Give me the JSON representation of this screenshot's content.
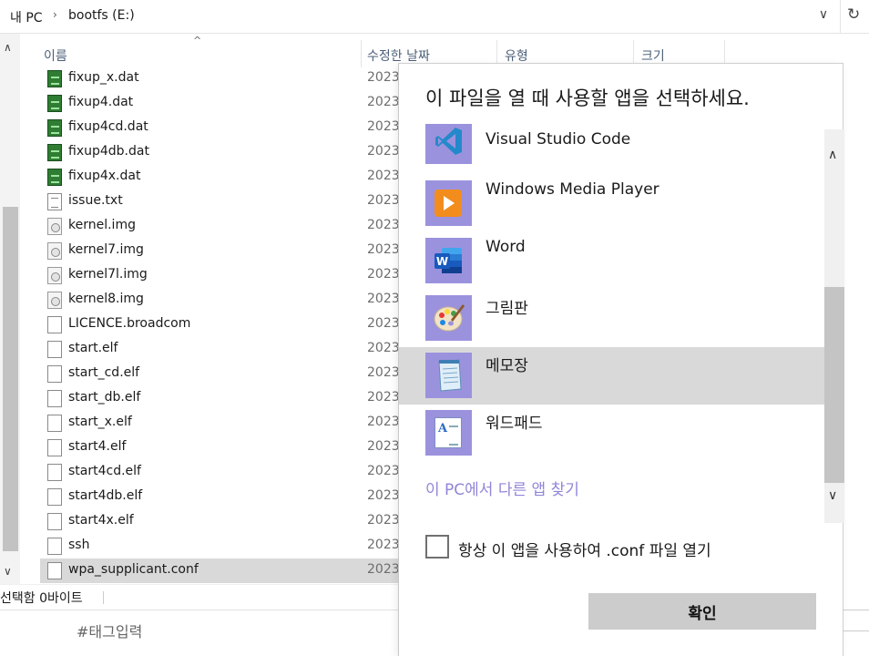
{
  "address_bar": {
    "crumbs": [
      "내 PC",
      "bootfs (E:)"
    ],
    "separator": "›",
    "dropdown_glyph": "∨",
    "refresh_glyph": "↻"
  },
  "columns": {
    "name": "이름",
    "modified": "수정한 날짜",
    "type": "유형",
    "size": "크기"
  },
  "files": [
    {
      "name": "fixup_x.dat",
      "date": "2023",
      "icon": "dat-file-icon"
    },
    {
      "name": "fixup4.dat",
      "date": "2023",
      "icon": "dat-file-icon"
    },
    {
      "name": "fixup4cd.dat",
      "date": "2023",
      "icon": "dat-file-icon"
    },
    {
      "name": "fixup4db.dat",
      "date": "2023",
      "icon": "dat-file-icon"
    },
    {
      "name": "fixup4x.dat",
      "date": "2023",
      "icon": "dat-file-icon"
    },
    {
      "name": "issue.txt",
      "date": "2023",
      "icon": "text-file-icon"
    },
    {
      "name": "kernel.img",
      "date": "2023",
      "icon": "disc-image-icon"
    },
    {
      "name": "kernel7.img",
      "date": "2023",
      "icon": "disc-image-icon"
    },
    {
      "name": "kernel7l.img",
      "date": "2023",
      "icon": "disc-image-icon"
    },
    {
      "name": "kernel8.img",
      "date": "2023",
      "icon": "disc-image-icon"
    },
    {
      "name": "LICENCE.broadcom",
      "date": "2023",
      "icon": "blank-file-icon"
    },
    {
      "name": "start.elf",
      "date": "2023",
      "icon": "blank-file-icon"
    },
    {
      "name": "start_cd.elf",
      "date": "2023",
      "icon": "blank-file-icon"
    },
    {
      "name": "start_db.elf",
      "date": "2023",
      "icon": "blank-file-icon"
    },
    {
      "name": "start_x.elf",
      "date": "2023",
      "icon": "blank-file-icon"
    },
    {
      "name": "start4.elf",
      "date": "2023",
      "icon": "blank-file-icon"
    },
    {
      "name": "start4cd.elf",
      "date": "2023",
      "icon": "blank-file-icon"
    },
    {
      "name": "start4db.elf",
      "date": "2023",
      "icon": "blank-file-icon"
    },
    {
      "name": "start4x.elf",
      "date": "2023",
      "icon": "blank-file-icon"
    },
    {
      "name": "ssh",
      "date": "2023",
      "icon": "blank-file-icon"
    },
    {
      "name": "wpa_supplicant.conf",
      "date": "2023",
      "icon": "blank-file-icon",
      "selected": true
    }
  ],
  "status_bar": {
    "text": "선택함 0바이트"
  },
  "tag_input": {
    "text": "#태그입력"
  },
  "dialog": {
    "title": "이 파일을 열 때 사용할 앱을 선택하세요.",
    "apps": [
      {
        "name": "Visual Studio Code",
        "icon": "vscode-icon"
      },
      {
        "name": "Windows Media Player",
        "icon": "media-player-icon"
      },
      {
        "name": "Word",
        "icon": "word-icon"
      },
      {
        "name": "그림판",
        "icon": "paint-icon"
      },
      {
        "name": "메모장",
        "icon": "notepad-icon",
        "selected": true
      },
      {
        "name": "워드패드",
        "icon": "wordpad-icon"
      }
    ],
    "more_apps_link": "이 PC에서 다른 앱 찾기",
    "always_use_label": "항상 이 앱을 사용하여 .conf 파일 열기",
    "always_use_checked": false,
    "ok_button": "확인",
    "accent_color": "#9b92de"
  }
}
